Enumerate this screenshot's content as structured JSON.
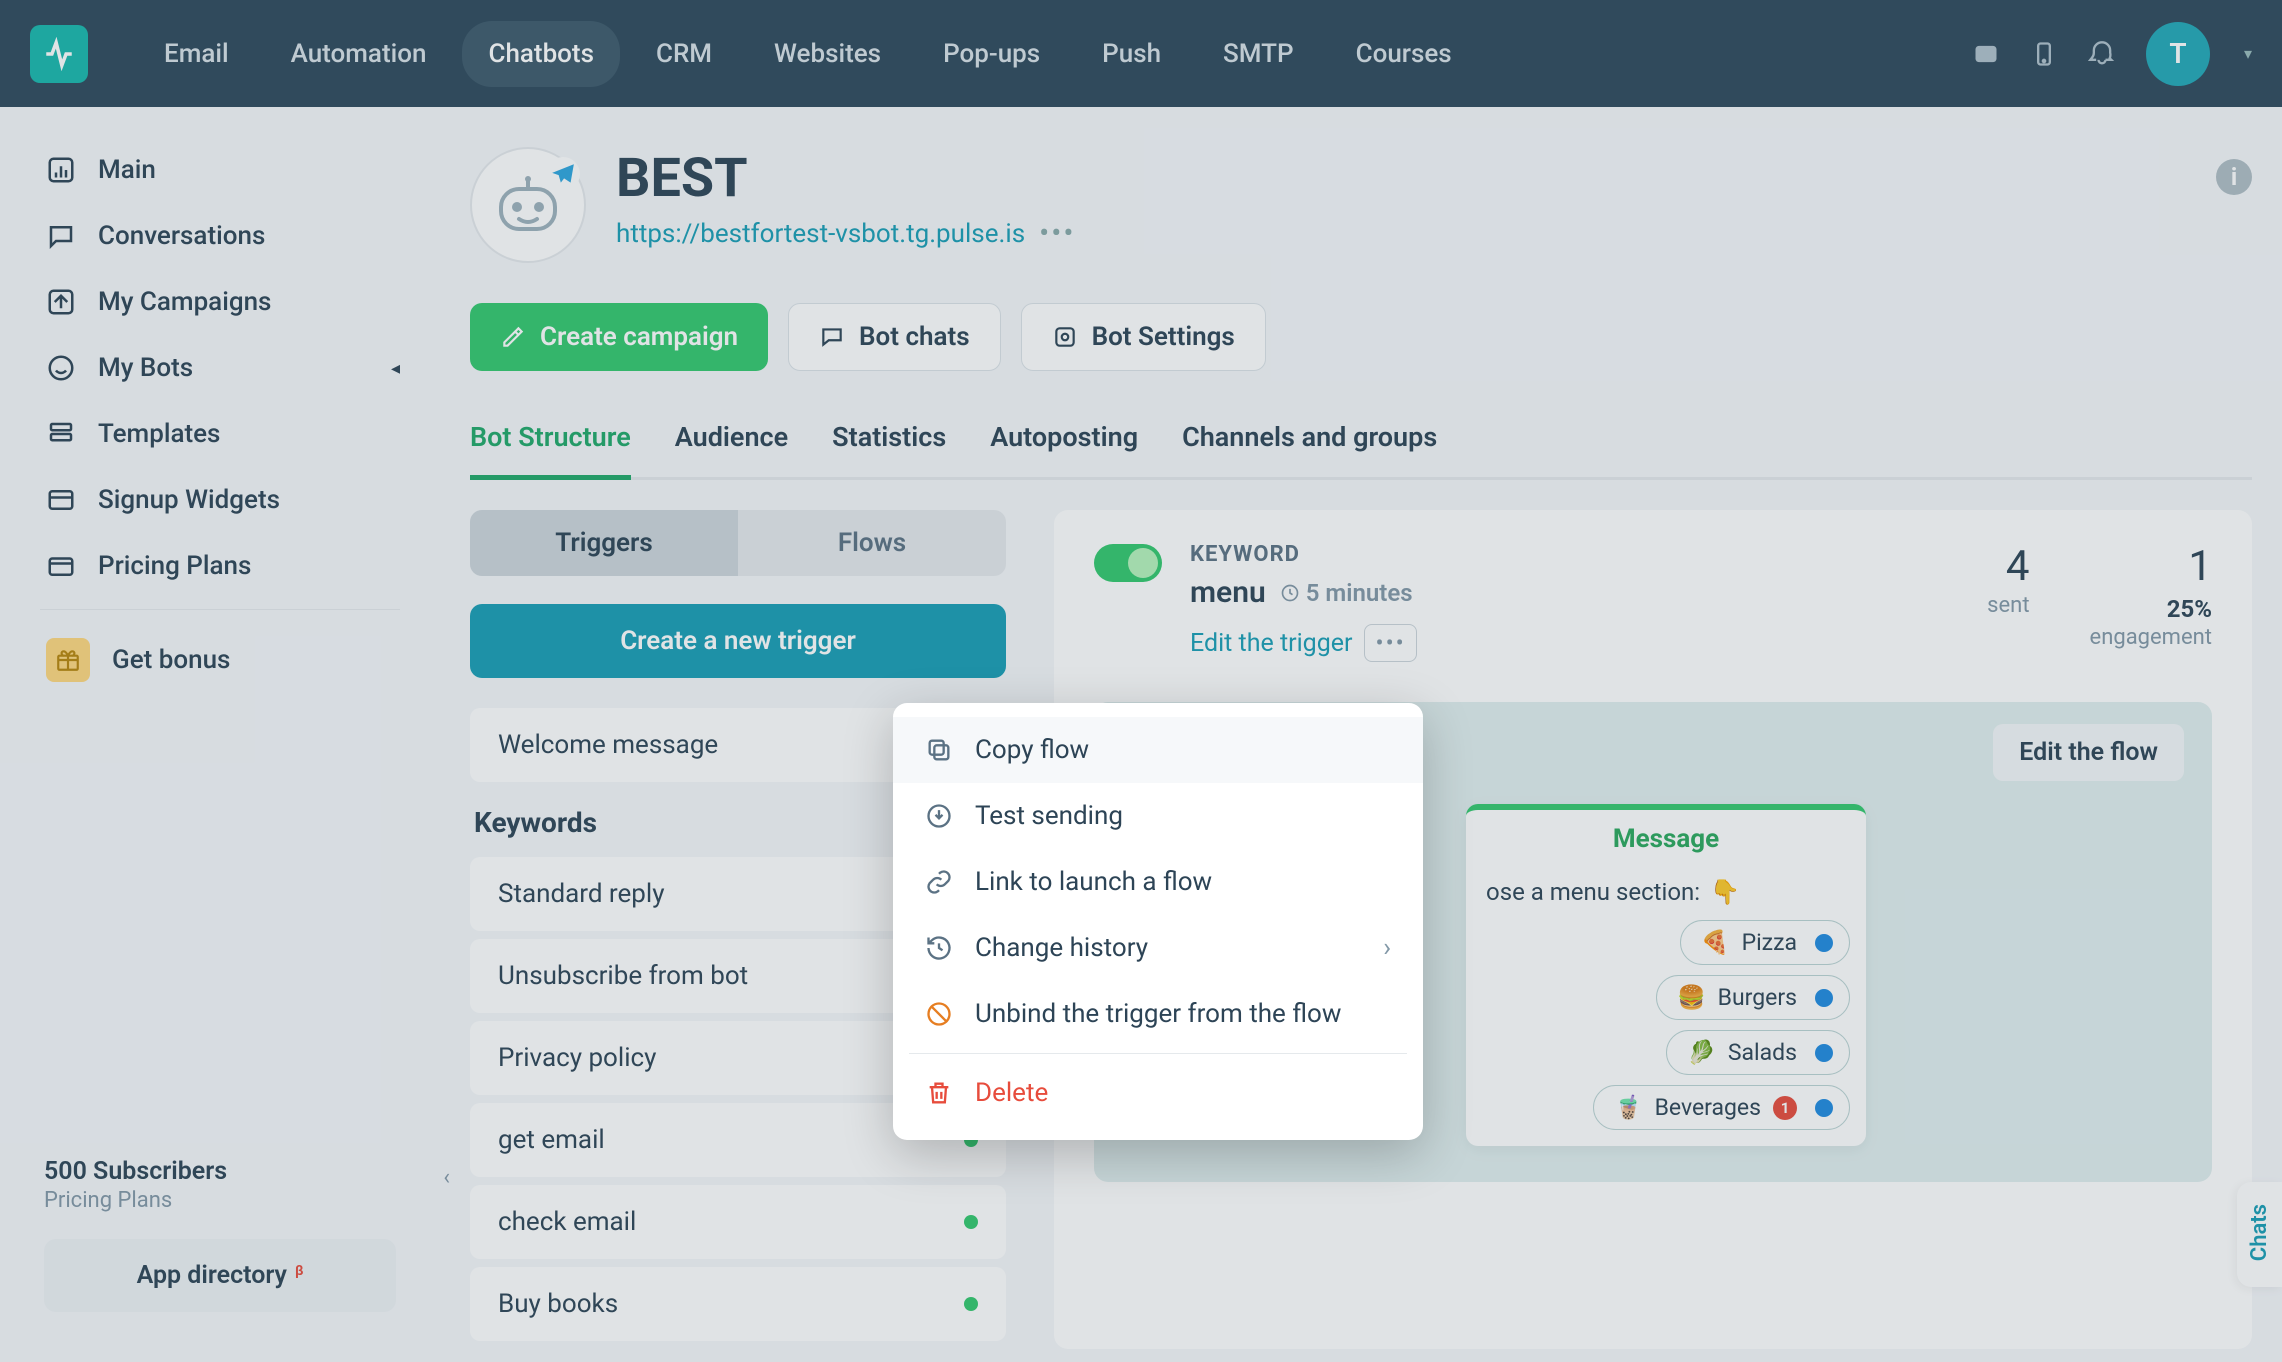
{
  "topnav": {
    "items": [
      "Email",
      "Automation",
      "Chatbots",
      "CRM",
      "Websites",
      "Pop-ups",
      "Push",
      "SMTP",
      "Courses"
    ],
    "active_index": 2,
    "avatar_initial": "T"
  },
  "sidebar": {
    "items": [
      {
        "label": "Main",
        "icon": "dashboard"
      },
      {
        "label": "Conversations",
        "icon": "chat"
      },
      {
        "label": "My Campaigns",
        "icon": "send"
      },
      {
        "label": "My Bots",
        "icon": "bot",
        "expandable": true
      },
      {
        "label": "Templates",
        "icon": "templates"
      },
      {
        "label": "Signup Widgets",
        "icon": "widget"
      },
      {
        "label": "Pricing Plans",
        "icon": "wallet"
      }
    ],
    "bonus_label": "Get bonus",
    "subscribers": "500 Subscribers",
    "subscribers_sub": "Pricing Plans",
    "app_directory": "App directory",
    "app_directory_badge": "β"
  },
  "bot": {
    "name": "BEST",
    "url": "https://bestfortest-vsbot.tg.pulse.is"
  },
  "actions": {
    "create_campaign": "Create campaign",
    "bot_chats": "Bot chats",
    "bot_settings": "Bot Settings"
  },
  "tabs": {
    "items": [
      "Bot Structure",
      "Audience",
      "Statistics",
      "Autoposting",
      "Channels and groups"
    ],
    "active_index": 0
  },
  "segment": {
    "triggers": "Triggers",
    "flows": "Flows"
  },
  "create_trigger": "Create a new trigger",
  "welcome_item": "Welcome message",
  "keywords_heading": "Keywords",
  "keywords": [
    {
      "label": "Standard reply",
      "dot": false
    },
    {
      "label": "Unsubscribe from bot",
      "dot": false
    },
    {
      "label": "Privacy policy",
      "dot": false
    },
    {
      "label": "get email",
      "dot": true
    },
    {
      "label": "check email",
      "dot": true
    },
    {
      "label": "Buy books",
      "dot": true
    }
  ],
  "right_panel": {
    "toggle_on": true,
    "keyword_label": "KEYWORD",
    "keyword_name": "menu",
    "time_ago": "5 minutes",
    "edit_trigger": "Edit the trigger",
    "sent_num": "4",
    "sent_label": "sent",
    "eng_num": "1",
    "eng_pct": "25%",
    "eng_label": "engagement",
    "edit_flow": "Edit the flow"
  },
  "message_card": {
    "title": "Message",
    "body": "ose a menu section:",
    "options": [
      {
        "emoji": "🍕",
        "label": "Pizza"
      },
      {
        "emoji": "🍔",
        "label": "Burgers"
      },
      {
        "emoji": "🥬",
        "label": "Salads"
      },
      {
        "emoji": "🧋",
        "label": "Beverages",
        "badge": "1"
      }
    ]
  },
  "context_menu": {
    "copy_flow": "Copy flow",
    "test_sending": "Test sending",
    "link_launch": "Link to launch a flow",
    "change_history": "Change history",
    "unbind": "Unbind the trigger from the flow",
    "delete": "Delete"
  },
  "chats_tab": "Chats"
}
